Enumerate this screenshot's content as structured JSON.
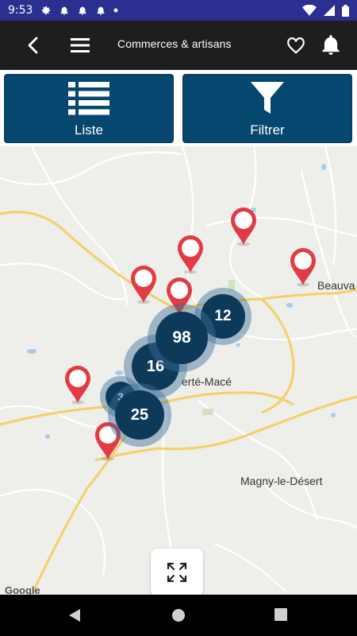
{
  "status_bar": {
    "time": "9:53",
    "left_icons": [
      "gear-icon",
      "notification-bell-icon",
      "notification-bell-icon",
      "notification-bell-icon",
      "dot-icon"
    ],
    "right_icons": [
      "wifi-icon",
      "signal-icon",
      "battery-icon"
    ]
  },
  "app_bar": {
    "title": "Commerces & artisans",
    "icons": [
      "back-arrow-icon",
      "hamburger-menu-icon",
      "heart-icon",
      "bell-icon"
    ]
  },
  "actions": {
    "list_label": "Liste",
    "filter_label": "Filtrer"
  },
  "map": {
    "place_labels": {
      "town_center": "erté-Macé",
      "east": "Beauva",
      "south": "Magny-le-Désert"
    },
    "clusters": [
      {
        "count": "98"
      },
      {
        "count": "12"
      },
      {
        "count": "16"
      },
      {
        "count": "25"
      },
      {
        "count": "3"
      }
    ],
    "marker_count": 7,
    "attribution": "Google",
    "expand_icon": "fullscreen-expand-icon",
    "colors": {
      "marker": "#e23b43",
      "cluster_core": "#0e3a5a",
      "road_major": "#f6d56e"
    }
  },
  "nav_bar": {
    "icons": [
      "back-triangle-icon",
      "home-circle-icon",
      "recents-square-icon"
    ]
  },
  "colors": {
    "status_bar": "#2b2f8f",
    "app_bar": "#1e1e1e",
    "action_button": "#05476e"
  }
}
